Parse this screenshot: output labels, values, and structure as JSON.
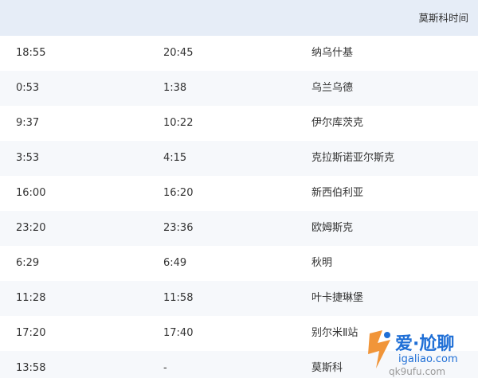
{
  "header": {
    "col1": "",
    "col2": "",
    "col3": "莫斯科时间"
  },
  "rows": [
    {
      "c1": "18:55",
      "c2": "20:45",
      "c3": "纳乌什基"
    },
    {
      "c1": "0:53",
      "c2": "1:38",
      "c3": "乌兰乌德"
    },
    {
      "c1": "9:37",
      "c2": "10:22",
      "c3": "伊尔库茨克"
    },
    {
      "c1": "3:53",
      "c2": "4:15",
      "c3": "克拉斯诺亚尔斯克"
    },
    {
      "c1": "16:00",
      "c2": "16:20",
      "c3": "新西伯利亚"
    },
    {
      "c1": "23:20",
      "c2": "23:36",
      "c3": "欧姆斯克"
    },
    {
      "c1": "6:29",
      "c2": "6:49",
      "c3": "秋明"
    },
    {
      "c1": "11:28",
      "c2": "11:58",
      "c3": "叶卡捷琳堡"
    },
    {
      "c1": "17:20",
      "c2": "17:40",
      "c3": "别尔米Ⅱ站"
    },
    {
      "c1": "13:58",
      "c2": "-",
      "c3": "莫斯科"
    }
  ],
  "watermark": {
    "brand": "爱·尬聊",
    "url": "igaliao.com",
    "url2": "qk9ufu.com"
  },
  "colors": {
    "header_bg": "#e6edf7",
    "alt_row_bg": "#f6f8fb",
    "watermark_blue": "#1f6fd6",
    "watermark_orange": "#f08a24"
  }
}
